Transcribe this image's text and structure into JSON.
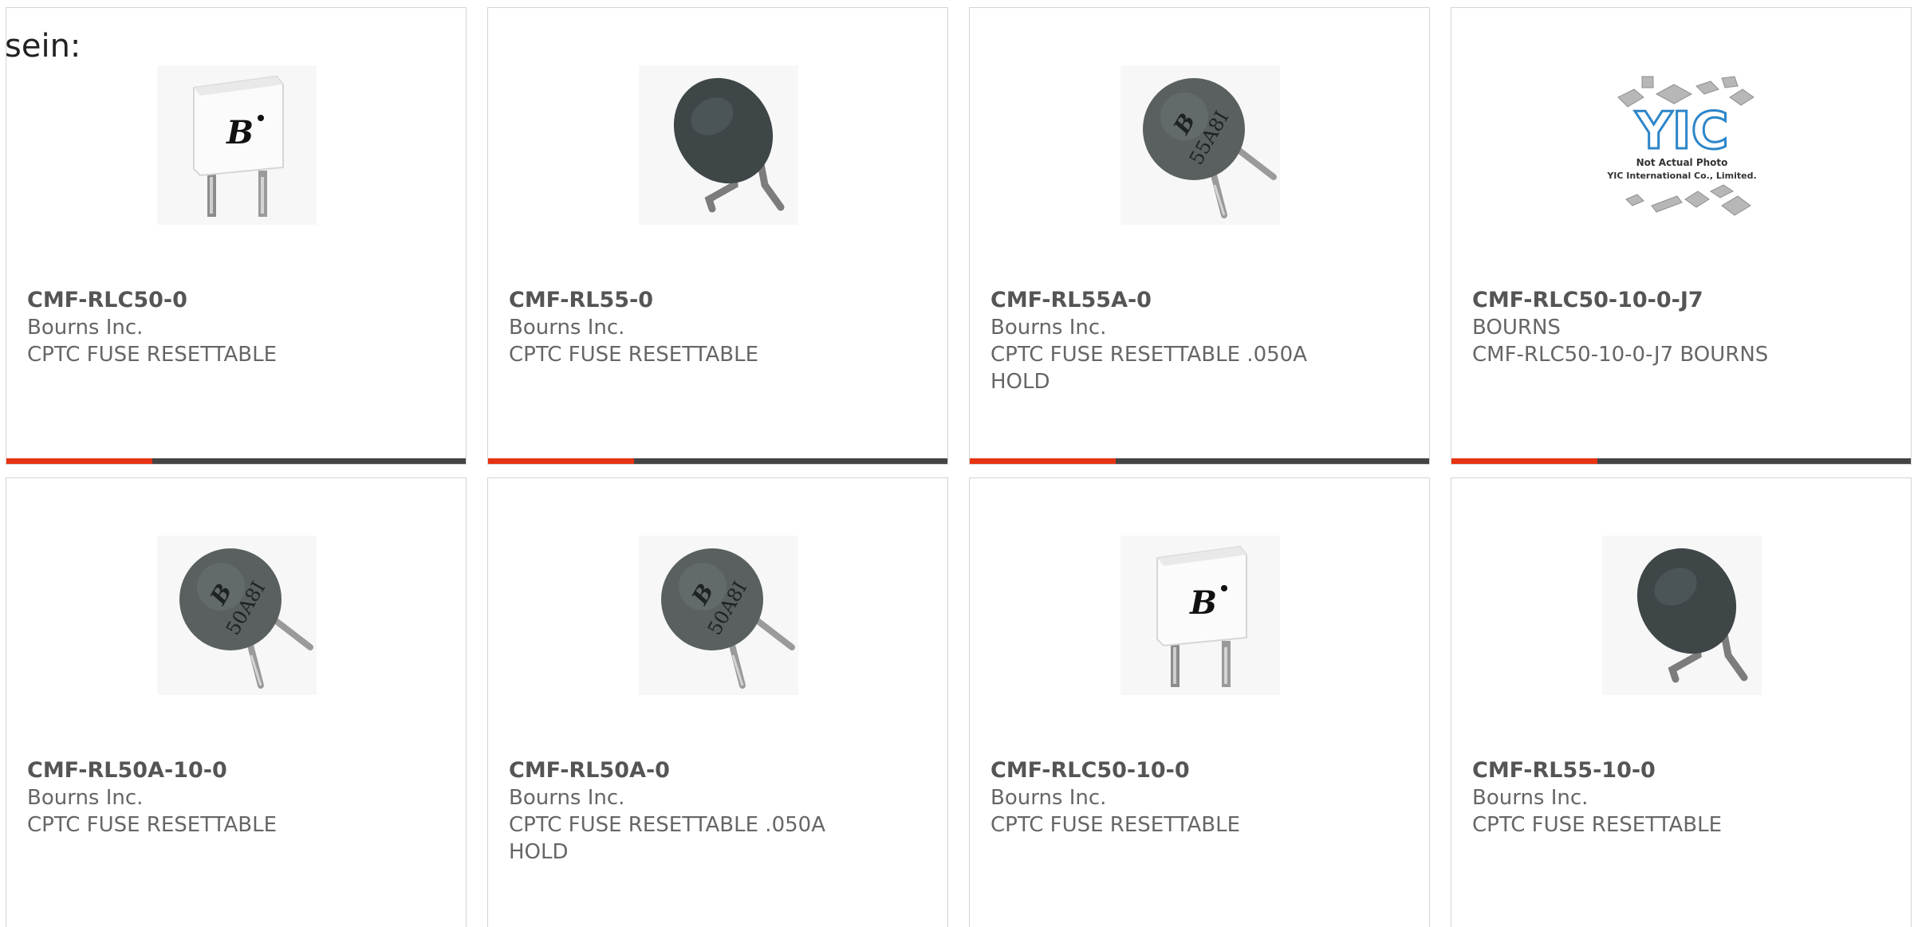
{
  "intro_text": "sein:",
  "colors": {
    "accent": "#e63312",
    "bar": "#444444",
    "part_number": "#555555",
    "body_text": "#666666",
    "card_border": "#d4d4d4"
  },
  "products": [
    {
      "part_number": "CMF-RLC50-0",
      "manufacturer": "Bourns Inc.",
      "description": "CPTC FUSE RESETTABLE",
      "image": "square-bourns-fuse-icon"
    },
    {
      "part_number": "CMF-RL55-0",
      "manufacturer": "Bourns Inc.",
      "description": "CPTC FUSE RESETTABLE",
      "image": "round-dark-fuse-icon"
    },
    {
      "part_number": "CMF-RL55A-0",
      "manufacturer": "Bourns Inc.",
      "description": "CPTC FUSE RESETTABLE .050A HOLD",
      "image": "round-marked-fuse-icon",
      "marking": "55A8I"
    },
    {
      "part_number": "CMF-RLC50-10-0-J7",
      "manufacturer": "BOURNS",
      "description": "CMF-RLC50-10-0-J7 BOURNS",
      "image": "placeholder-yic-icon",
      "placeholder": {
        "logo": "YIC",
        "line1": "Not Actual Photo",
        "line2": "YIC International Co., Limited."
      }
    },
    {
      "part_number": "CMF-RL50A-10-0",
      "manufacturer": "Bourns Inc.",
      "description": "CPTC FUSE RESETTABLE",
      "image": "round-marked-fuse-icon",
      "marking": "50A8I"
    },
    {
      "part_number": "CMF-RL50A-0",
      "manufacturer": "Bourns Inc.",
      "description": "CPTC FUSE RESETTABLE .050A HOLD",
      "image": "round-marked-fuse-icon",
      "marking": "50A8I"
    },
    {
      "part_number": "CMF-RLC50-10-0",
      "manufacturer": "Bourns Inc.",
      "description": "CPTC FUSE RESETTABLE",
      "image": "square-bourns-fuse-icon"
    },
    {
      "part_number": "CMF-RL55-10-0",
      "manufacturer": "Bourns Inc.",
      "description": "CPTC FUSE RESETTABLE",
      "image": "round-dark-fuse-icon"
    }
  ]
}
